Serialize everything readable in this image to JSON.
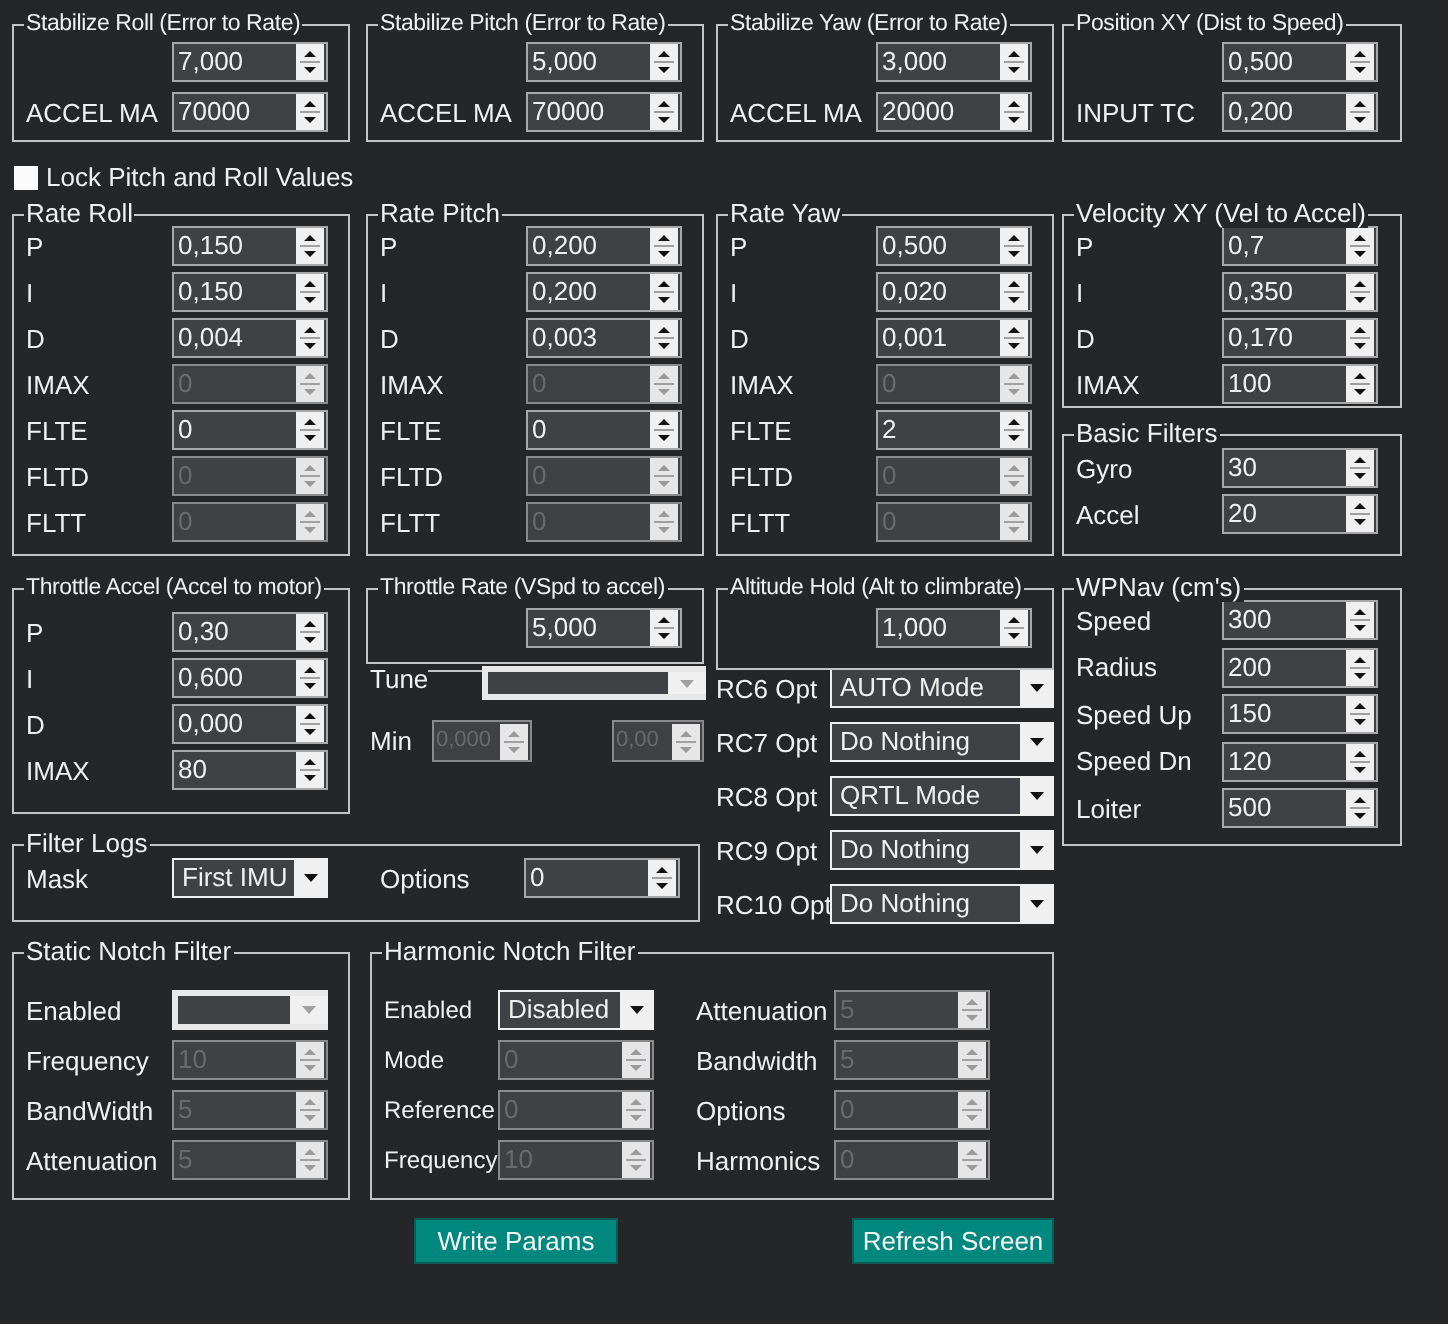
{
  "groups": [
    {
      "title": "Stabilize Roll (Error to Rate)",
      "fields": [
        {
          "kind": "spin",
          "value": "7,000",
          "disabled": false
        },
        {
          "label": "ACCEL MA",
          "kind": "spin",
          "value": "70000",
          "disabled": false
        }
      ]
    },
    {
      "title": "Stabilize Pitch (Error to Rate)",
      "fields": [
        {
          "kind": "spin",
          "value": "5,000",
          "disabled": false
        },
        {
          "label": "ACCEL MA",
          "kind": "spin",
          "value": "70000",
          "disabled": false
        }
      ]
    },
    {
      "title": "Stabilize Yaw (Error to Rate)",
      "fields": [
        {
          "kind": "spin",
          "value": "3,000",
          "disabled": false
        },
        {
          "label": "ACCEL MA",
          "kind": "spin",
          "value": "20000",
          "disabled": false
        }
      ]
    },
    {
      "title": "Position XY (Dist to Speed)",
      "fields": [
        {
          "kind": "spin",
          "value": "0,500",
          "disabled": false
        },
        {
          "label": "INPUT TC",
          "kind": "spin",
          "value": "0,200",
          "disabled": false
        }
      ]
    },
    {
      "title": "Rate Roll",
      "fields": [
        {
          "label": "P",
          "kind": "spin",
          "value": "0,150",
          "disabled": false
        },
        {
          "label": "I",
          "kind": "spin",
          "value": "0,150",
          "disabled": false
        },
        {
          "label": "D",
          "kind": "spin",
          "value": "0,004",
          "disabled": false
        },
        {
          "label": "IMAX",
          "kind": "spin",
          "value": "0",
          "disabled": true
        },
        {
          "label": "FLTE",
          "kind": "spin",
          "value": "0",
          "disabled": false
        },
        {
          "label": "FLTD",
          "kind": "spin",
          "value": "0",
          "disabled": true
        },
        {
          "label": "FLTT",
          "kind": "spin",
          "value": "0",
          "disabled": true
        }
      ]
    },
    {
      "title": "Rate Pitch",
      "fields": [
        {
          "label": "P",
          "kind": "spin",
          "value": "0,200",
          "disabled": false
        },
        {
          "label": "I",
          "kind": "spin",
          "value": "0,200",
          "disabled": false
        },
        {
          "label": "D",
          "kind": "spin",
          "value": "0,003",
          "disabled": false
        },
        {
          "label": "IMAX",
          "kind": "spin",
          "value": "0",
          "disabled": true
        },
        {
          "label": "FLTE",
          "kind": "spin",
          "value": "0",
          "disabled": false
        },
        {
          "label": "FLTD",
          "kind": "spin",
          "value": "0",
          "disabled": true
        },
        {
          "label": "FLTT",
          "kind": "spin",
          "value": "0",
          "disabled": true
        }
      ]
    },
    {
      "title": "Rate Yaw",
      "fields": [
        {
          "label": "P",
          "kind": "spin",
          "value": "0,500",
          "disabled": false
        },
        {
          "label": "I",
          "kind": "spin",
          "value": "0,020",
          "disabled": false
        },
        {
          "label": "D",
          "kind": "spin",
          "value": "0,001",
          "disabled": false
        },
        {
          "label": "IMAX",
          "kind": "spin",
          "value": "0",
          "disabled": true
        },
        {
          "label": "FLTE",
          "kind": "spin",
          "value": "2",
          "disabled": false
        },
        {
          "label": "FLTD",
          "kind": "spin",
          "value": "0",
          "disabled": true
        },
        {
          "label": "FLTT",
          "kind": "spin",
          "value": "0",
          "disabled": true
        }
      ]
    },
    {
      "title": "Velocity XY (Vel to Accel)",
      "fields": [
        {
          "label": "P",
          "kind": "spin",
          "value": "0,7",
          "disabled": false
        },
        {
          "label": "I",
          "kind": "spin",
          "value": "0,350",
          "disabled": false
        },
        {
          "label": "D",
          "kind": "spin",
          "value": "0,170",
          "disabled": false
        },
        {
          "label": "IMAX",
          "kind": "spin",
          "value": "100",
          "disabled": false
        }
      ]
    },
    {
      "title": "Basic Filters",
      "fields": [
        {
          "label": "Gyro",
          "kind": "spin",
          "value": "30",
          "disabled": false
        },
        {
          "label": "Accel",
          "kind": "spin",
          "value": "20",
          "disabled": false
        }
      ]
    },
    {
      "title": "Throttle Accel (Accel to motor)",
      "fields": [
        {
          "label": "P",
          "kind": "spin",
          "value": "0,30",
          "disabled": false
        },
        {
          "label": "I",
          "kind": "spin",
          "value": "0,600",
          "disabled": false
        },
        {
          "label": "D",
          "kind": "spin",
          "value": "0,000",
          "disabled": false
        },
        {
          "label": "IMAX",
          "kind": "spin",
          "value": "80",
          "disabled": false
        }
      ]
    },
    {
      "title": "Throttle Rate (VSpd to accel)",
      "fields": [
        {
          "kind": "spin",
          "value": "5,000",
          "disabled": false
        }
      ]
    },
    {
      "title": "Altitude Hold (Alt to climbrate)",
      "fields": [
        {
          "kind": "spin",
          "value": "1,000",
          "disabled": false
        }
      ]
    },
    {
      "title": "WPNav (cm's)",
      "fields": [
        {
          "label": "Speed",
          "kind": "spin",
          "value": "300",
          "disabled": false
        },
        {
          "label": "Radius",
          "kind": "spin",
          "value": "200",
          "disabled": false
        },
        {
          "label": "Speed Up",
          "kind": "spin",
          "value": "150",
          "disabled": false
        },
        {
          "label": "Speed Dn",
          "kind": "spin",
          "value": "120",
          "disabled": false
        },
        {
          "label": "Loiter",
          "kind": "spin",
          "value": "500",
          "disabled": false
        }
      ]
    },
    {
      "title": "Filter Logs",
      "fields": [
        {
          "label": "Mask",
          "kind": "combo",
          "value": "First IMU",
          "disabled": false
        },
        {
          "label": "Options",
          "kind": "spin",
          "value": "0",
          "disabled": false
        }
      ]
    },
    {
      "title": "Static Notch Filter",
      "fields": [
        {
          "label": "Enabled",
          "kind": "combo",
          "disabled": true
        },
        {
          "label": "Frequency",
          "kind": "spin",
          "value": "10",
          "disabled": true
        },
        {
          "label": "BandWidth",
          "kind": "spin",
          "value": "5",
          "disabled": true
        },
        {
          "label": "Attenuation",
          "kind": "spin",
          "value": "5",
          "disabled": true
        }
      ]
    },
    {
      "title": "Harmonic Notch Filter",
      "fields": [
        {
          "label": "Enabled",
          "kind": "combo",
          "value": "Disabled",
          "disabled": false
        },
        {
          "label": "Mode",
          "kind": "spin",
          "value": "0",
          "disabled": true
        },
        {
          "label": "Reference",
          "kind": "spin",
          "value": "0",
          "disabled": true
        },
        {
          "label": "Frequency",
          "kind": "spin",
          "value": "10",
          "disabled": true
        },
        {
          "label": "Attenuation",
          "kind": "spin",
          "value": "5",
          "disabled": true
        },
        {
          "label": "Bandwidth",
          "kind": "spin",
          "value": "5",
          "disabled": true
        },
        {
          "label": "Options",
          "kind": "spin",
          "value": "0",
          "disabled": true
        },
        {
          "label": "Harmonics",
          "kind": "spin",
          "value": "0",
          "disabled": true
        }
      ]
    }
  ],
  "lock": {
    "label": "Lock Pitch and Roll Values",
    "checked": false
  },
  "tune": {
    "label": "Tune",
    "kind": "combo",
    "disabled": true
  },
  "min": {
    "label": "Min",
    "fields": [
      {
        "kind": "spin",
        "value": "0,000",
        "disabled": true
      },
      {
        "kind": "spin",
        "value": "0,00",
        "disabled": true
      }
    ]
  },
  "rc_options": [
    {
      "label": "RC6 Opt",
      "kind": "combo",
      "value": "AUTO Mode",
      "disabled": false
    },
    {
      "label": "RC7 Opt",
      "kind": "combo",
      "value": "Do Nothing",
      "disabled": false
    },
    {
      "label": "RC8 Opt",
      "kind": "combo",
      "value": "QRTL Mode",
      "disabled": false
    },
    {
      "label": "RC9 Opt",
      "kind": "combo",
      "value": "Do Nothing",
      "disabled": false
    },
    {
      "label": "RC10 Opt",
      "kind": "combo",
      "value": "Do Nothing",
      "disabled": false
    }
  ],
  "buttons": [
    "Write Params",
    "Refresh Screen"
  ]
}
